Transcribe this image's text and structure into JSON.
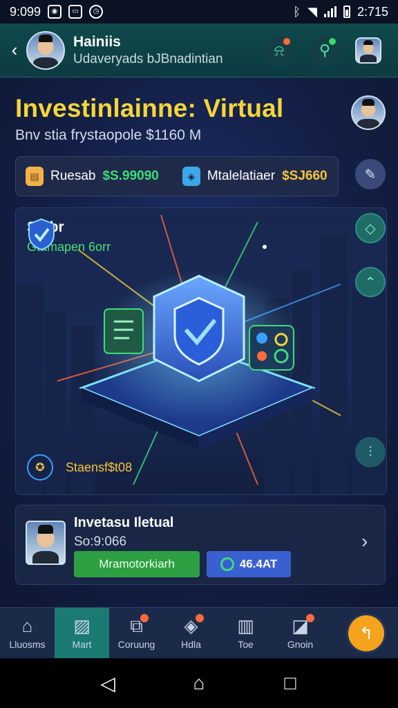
{
  "status_bar": {
    "left_text": "9:099",
    "time": "2:715"
  },
  "header": {
    "title": "Hainiis",
    "subtitle": "Udaveryads bJBnadintian"
  },
  "hero": {
    "title": "Investinlainne: Virtual",
    "subtitle": "Bnv stia frystaopole $1160 M"
  },
  "stats": {
    "item1_label": "Ruesab",
    "item1_value": "$S.99090",
    "item2_label": "Mtalelatiaer",
    "item2_value": "$SJ660"
  },
  "feature": {
    "title": "Stabr",
    "subtitle": "Gtamapen 6orr",
    "footer_label": "Staensf$t08"
  },
  "profile": {
    "name": "Invetasu Iletual",
    "sub": "So:9:066",
    "green_button": "Mramotorkiarh",
    "blue_button": "46.4AT"
  },
  "nav": {
    "items": [
      {
        "label": "Lluosms"
      },
      {
        "label": "Mart"
      },
      {
        "label": "Coruung"
      },
      {
        "label": "Hdla"
      },
      {
        "label": "Toe"
      },
      {
        "label": "Gnoin"
      }
    ]
  },
  "colors": {
    "accent_gold": "#f5d53a",
    "accent_green": "#3ddc7a",
    "nav_active": "#1b7a72",
    "fab": "#f5a31c"
  }
}
